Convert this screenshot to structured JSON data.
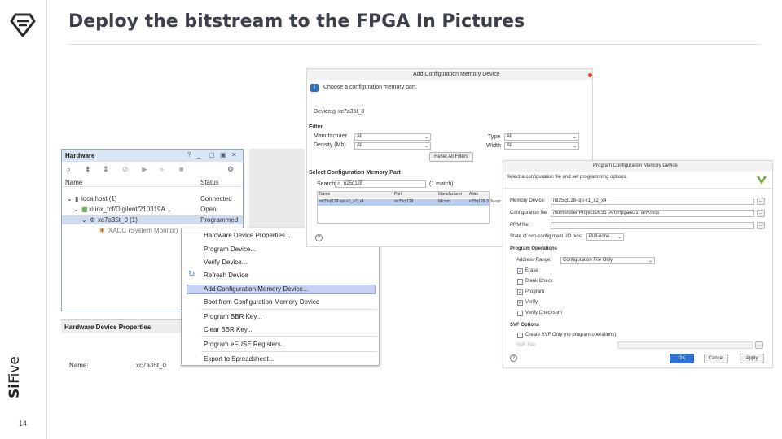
{
  "slide": {
    "title": "Deploy the bitstream to the FPGA In Pictures",
    "brand_si": "Si",
    "brand_five": "Five",
    "page_number": "14"
  },
  "hardware_panel": {
    "title": "Hardware",
    "header_icons": [
      "help-icon",
      "restore-icon",
      "minimize-icon",
      "maximize-icon",
      "close-icon"
    ],
    "toolbar_icons": [
      "search-icon",
      "collapse-icon",
      "expand-icon",
      "disconnect-icon",
      "run-icon",
      "skip-icon",
      "stop-icon",
      "gear-icon"
    ],
    "columns": {
      "name": "Name",
      "status": "Status"
    },
    "rows": [
      {
        "name": "localhost (1)",
        "status": "Connected"
      },
      {
        "name": "xilinx_tcf/Digilent/210319A...",
        "status": "Open"
      },
      {
        "name": "xc7a35t_0 (1)",
        "status": "Programmed"
      },
      {
        "name": "XADC (System Monitor)",
        "status": ""
      }
    ]
  },
  "properties_panel": {
    "title": "Hardware Device Properties",
    "name_label": "Name:",
    "name_value": "xc7a35t_0"
  },
  "context_menu": {
    "items": [
      "Hardware Device Properties...",
      "Program Device...",
      "Verify Device...",
      "Refresh Device",
      "Add Configuration Memory Device...",
      "Boot from Configuration Memory Device",
      "Program BBR Key...",
      "Clear BBR Key...",
      "Program eFUSE Registers...",
      "Export to Spreadsheet..."
    ],
    "highlighted_index": 4
  },
  "add_memory_dialog": {
    "title": "Add Configuration Memory Device",
    "subtitle": "Choose a configuration memory part.",
    "device_label": "Device:",
    "device_value": "xc7a35t_0",
    "filter_label": "Filter",
    "manufacturer_label": "Manufacturer",
    "manufacturer_value": "All",
    "density_label": "Density (Mb)",
    "density_value": "All",
    "type_label": "Type",
    "type_value": "All",
    "width_label": "Width",
    "width_value": "All",
    "reset_button": "Reset All Filters",
    "select_label": "Select Configuration Memory Part",
    "search_label": "Search:",
    "search_value": "n25q128",
    "match_count": "(1 match)",
    "table_columns": [
      "Name",
      "Part",
      "Manufacturer",
      "Alias"
    ],
    "table_row": [
      "mt25ql128-spi-x1_x2_x4",
      "mt25ql128",
      "Micron",
      "n25q128-3.3v-spi"
    ]
  },
  "program_memory_dialog": {
    "title": "Program Configuration Memory Device",
    "subtitle": "Select a configuration file and set programming options.",
    "memory_device_label": "Memory Device:",
    "memory_device_value": "mt25ql128-spi-x1_x2_x4",
    "config_file_label": "Configuration file:",
    "config_file_value": "/home/user/Projects/E31_Arty/fpga/e31_arty.mcs",
    "prm_file_label": "PRM file:",
    "prm_file_value": "",
    "state_label": "State of non-config mem I/O pins:",
    "state_value": "Pull-none",
    "ops_label": "Program Operations",
    "address_range_label": "Address Range:",
    "address_range_value": "Configuration File Only",
    "options": [
      {
        "label": "Erase",
        "checked": true
      },
      {
        "label": "Blank Check",
        "checked": false
      },
      {
        "label": "Program",
        "checked": true
      },
      {
        "label": "Verify",
        "checked": true
      },
      {
        "label": "Verify Checksum",
        "checked": false
      }
    ],
    "svf_label": "SVF Options",
    "svf_create_label": "Create SVF Only (no program operations)",
    "svf_file_label": "SVF File:",
    "ok_button": "OK",
    "cancel_button": "Cancel",
    "apply_button": "Apply"
  }
}
